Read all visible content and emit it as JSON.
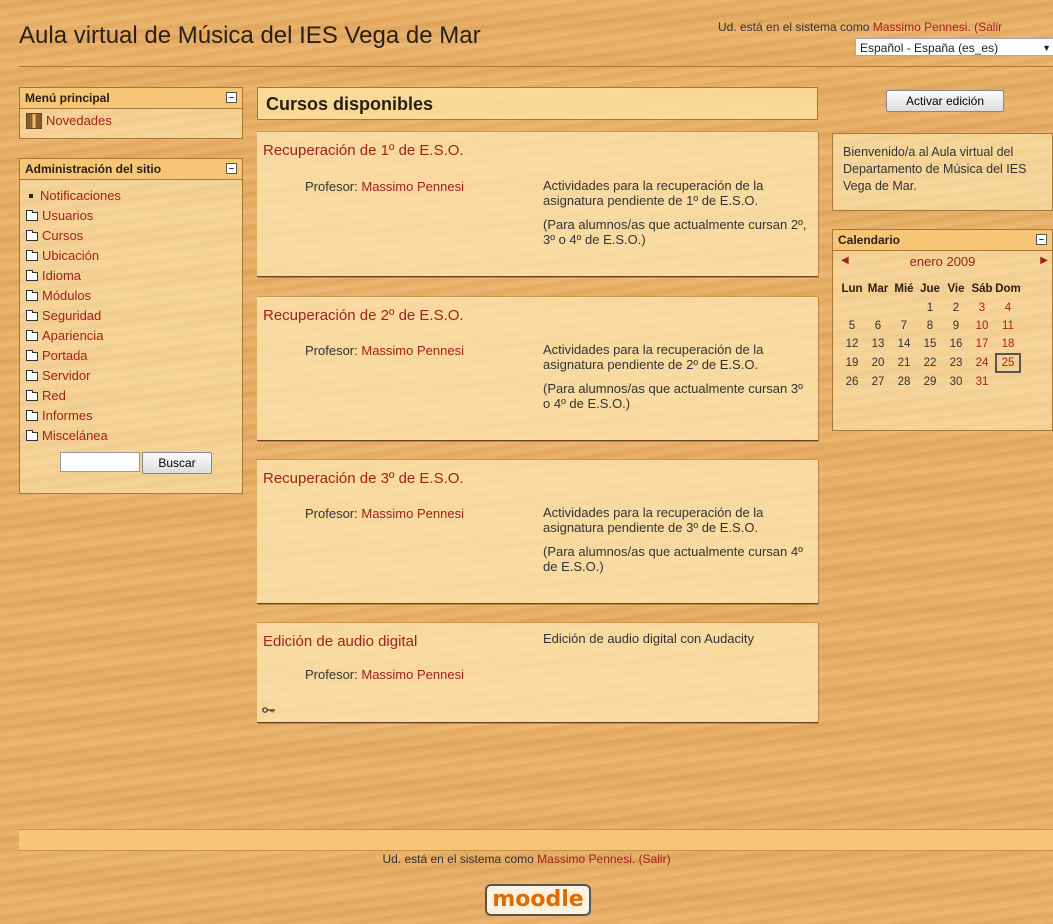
{
  "header": {
    "site_title": "Aula virtual de Música del IES Vega de Mar",
    "login_prefix": "Ud. está en el sistema como ",
    "user_name": "Massimo Pennesi.",
    "logout": "(Salir",
    "language": "Español - España (es_es)"
  },
  "main_menu": {
    "title": "Menú principal",
    "items": [
      {
        "label": "Novedades",
        "icon": "news-icon"
      }
    ]
  },
  "admin": {
    "title": "Administración del sitio",
    "items": [
      {
        "label": "Notificaciones",
        "icon": "bullet"
      },
      {
        "label": "Usuarios",
        "icon": "folder-icon"
      },
      {
        "label": "Cursos",
        "icon": "folder-icon"
      },
      {
        "label": "Ubicación",
        "icon": "folder-icon"
      },
      {
        "label": "Idioma",
        "icon": "folder-icon"
      },
      {
        "label": "Módulos",
        "icon": "folder-icon"
      },
      {
        "label": "Seguridad",
        "icon": "folder-icon"
      },
      {
        "label": "Apariencia",
        "icon": "folder-icon"
      },
      {
        "label": "Portada",
        "icon": "folder-icon"
      },
      {
        "label": "Servidor",
        "icon": "folder-icon"
      },
      {
        "label": "Red",
        "icon": "folder-icon"
      },
      {
        "label": "Informes",
        "icon": "folder-icon"
      },
      {
        "label": "Miscelánea",
        "icon": "folder-icon"
      }
    ],
    "search_button": "Buscar",
    "search_value": ""
  },
  "center": {
    "title": "Cursos disponibles",
    "teacher_label": "Profesor: ",
    "courses": [
      {
        "title": "Recuperación de 1º de E.S.O.",
        "teacher": "Massimo Pennesi",
        "summary": [
          "Actividades para la recuperación de la asignatura pendiente de 1º de E.S.O.",
          "(Para alumnos/as que actualmente cursan 2º, 3º o 4º de E.S.O.)"
        ]
      },
      {
        "title": "Recuperación de 2º de E.S.O.",
        "teacher": "Massimo Pennesi",
        "summary": [
          "Actividades para la recuperación de la asignatura pendiente de 2º de E.S.O.",
          "(Para alumnos/as que actualmente cursan 3º o 4º de E.S.O.)"
        ]
      },
      {
        "title": "Recuperación de 3º de E.S.O.",
        "teacher": "Massimo Pennesi",
        "summary": [
          "Actividades para la recuperación de la asignatura pendiente de 3º de E.S.O.",
          "(Para alumnos/as que actualmente cursan 4º de E.S.O.)"
        ]
      },
      {
        "title": "Edición de audio digital",
        "teacher": "Massimo Pennesi",
        "summary": [
          "Edición de audio digital con Audacity"
        ]
      }
    ]
  },
  "right": {
    "edit_button": "Activar edición",
    "welcome": "Bienvenido/a al Aula virtual del Departamento de Música del IES Vega de Mar.",
    "calendar": {
      "title": "Calendario",
      "month": "enero 2009",
      "weekdays": [
        "Lun",
        "Mar",
        "Mié",
        "Jue",
        "Vie",
        "Sáb",
        "Dom"
      ],
      "weeks": [
        [
          "",
          "",
          "",
          "1",
          "2",
          "3",
          "4"
        ],
        [
          "5",
          "6",
          "7",
          "8",
          "9",
          "10",
          "11"
        ],
        [
          "12",
          "13",
          "14",
          "15",
          "16",
          "17",
          "18"
        ],
        [
          "19",
          "20",
          "21",
          "22",
          "23",
          "24",
          "25"
        ],
        [
          "26",
          "27",
          "28",
          "29",
          "30",
          "31",
          ""
        ]
      ],
      "today": "25"
    }
  },
  "footer": {
    "login_prefix": "Ud. está en el sistema como ",
    "user_name": "Massimo Pennesi.",
    "logout": "(Salir)",
    "logo_text": "moodle"
  },
  "colors": {
    "link": "#a3211c",
    "block_header": "#f6c676",
    "background": "#e9ad62"
  }
}
